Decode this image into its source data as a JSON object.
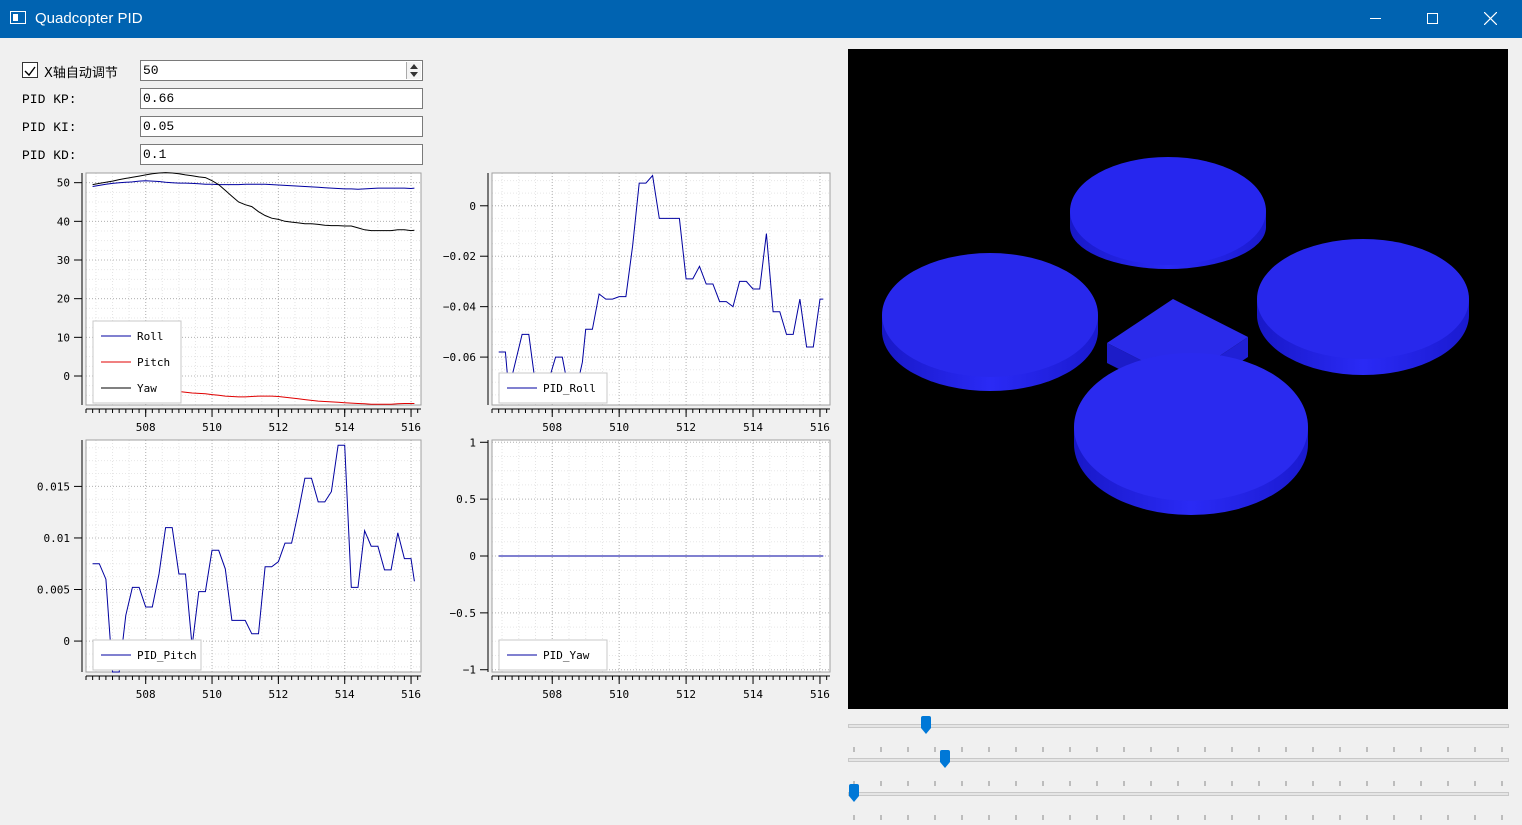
{
  "window": {
    "title": "Quadcopter PID"
  },
  "controls": {
    "auto_tune_label": "X轴自动调节",
    "auto_tune_checked": true,
    "spin_value": "50",
    "kp_label": "PID KP:",
    "kp_value": "0.66",
    "ki_label": "PID KI:",
    "ki_value": "0.05",
    "kd_label": "PID KD:",
    "kd_value": "0.1"
  },
  "chart_data": [
    {
      "type": "line",
      "x": [
        506.4,
        506.6,
        506.8,
        507.0,
        507.2,
        507.4,
        507.6,
        507.8,
        508.0,
        508.2,
        508.4,
        508.6,
        508.8,
        509.0,
        509.2,
        509.4,
        509.6,
        509.8,
        510.0,
        510.2,
        510.4,
        510.6,
        510.8,
        511.0,
        511.2,
        511.4,
        511.6,
        511.8,
        512.0,
        512.2,
        512.4,
        512.6,
        512.8,
        513.0,
        513.2,
        513.4,
        513.6,
        513.8,
        514.0,
        514.2,
        514.4,
        514.6,
        514.8,
        515.0,
        515.2,
        515.4,
        515.6,
        515.8,
        516.0,
        516.1
      ],
      "series": [
        {
          "name": "Roll",
          "color": "#0000a0",
          "values": [
            49,
            49.3,
            49.6,
            49.8,
            50,
            50.1,
            50.2,
            50.4,
            50.5,
            50.4,
            50.3,
            50.1,
            50,
            49.9,
            49.9,
            49.8,
            49.7,
            49.6,
            49.6,
            49.5,
            49.5,
            49.5,
            49.5,
            49.6,
            49.6,
            49.6,
            49.6,
            49.5,
            49.4,
            49.3,
            49.2,
            49.1,
            49,
            48.9,
            48.8,
            48.7,
            48.6,
            48.5,
            48.4,
            48.4,
            48.3,
            48.4,
            48.5,
            48.6,
            48.6,
            48.6,
            48.6,
            48.6,
            48.5,
            48.6
          ]
        },
        {
          "name": "Pitch",
          "color": "#e00000",
          "values": [
            -1.3,
            -1.5,
            -1.8,
            -2,
            -2.2,
            -2.4,
            -2.6,
            -2.8,
            -3,
            -3.2,
            -3.4,
            -3.6,
            -3.8,
            -4,
            -4.2,
            -4.4,
            -4.5,
            -4.6,
            -4.8,
            -5,
            -5.2,
            -5.3,
            -5.4,
            -5.4,
            -5.3,
            -5.2,
            -5.2,
            -5.2,
            -5.3,
            -5.5,
            -5.7,
            -5.9,
            -6.1,
            -6.3,
            -6.5,
            -6.6,
            -6.7,
            -6.8,
            -6.9,
            -7,
            -7.1,
            -7.2,
            -7.3,
            -7.3,
            -7.3,
            -7.3,
            -7.2,
            -7.1,
            -7.1,
            -7.1
          ]
        },
        {
          "name": "Yaw",
          "color": "#000000",
          "values": [
            49.5,
            49.8,
            50.1,
            50.4,
            50.8,
            51.1,
            51.4,
            51.7,
            52,
            52.3,
            52.5,
            52.6,
            52.5,
            52.3,
            52,
            51.8,
            51.5,
            51.3,
            50.5,
            49.5,
            48,
            46.5,
            45,
            44.3,
            43.8,
            42.5,
            41.5,
            40.8,
            40.5,
            40,
            39.8,
            39.6,
            39.4,
            39.4,
            39.2,
            39,
            38.9,
            38.9,
            38.8,
            38.8,
            38.3,
            37.8,
            37.6,
            37.6,
            37.6,
            37.6,
            37.8,
            37.8,
            37.6,
            37.7
          ]
        }
      ],
      "xlim": [
        506.2,
        516.3
      ],
      "ylim": [
        -7.5,
        52.5
      ],
      "xticks": [
        508,
        510,
        512,
        514,
        516
      ],
      "yticks": [
        0,
        10,
        20,
        30,
        40,
        50
      ],
      "ytick_labels": [
        "0",
        "10",
        "20",
        "30",
        "40",
        "50"
      ],
      "legend": "bottom-left",
      "grid": true
    },
    {
      "type": "line",
      "x": [
        506.4,
        506.6,
        506.7,
        506.9,
        507.1,
        507.3,
        507.5,
        507.7,
        507.9,
        508.1,
        508.3,
        508.5,
        508.7,
        508.9,
        509.0,
        509.2,
        509.4,
        509.6,
        509.8,
        510.0,
        510.2,
        510.4,
        510.6,
        510.8,
        511.0,
        511.2,
        511.4,
        511.6,
        511.8,
        512.0,
        512.2,
        512.4,
        512.6,
        512.8,
        513.0,
        513.2,
        513.4,
        513.6,
        513.8,
        514.0,
        514.2,
        514.4,
        514.6,
        514.8,
        515.0,
        515.2,
        515.4,
        515.6,
        515.8,
        516.0,
        516.1
      ],
      "series": [
        {
          "name": "PID_Roll",
          "color": "#0000a0",
          "values": [
            -0.058,
            -0.058,
            -0.073,
            -0.062,
            -0.051,
            -0.051,
            -0.071,
            -0.069,
            -0.069,
            -0.06,
            -0.06,
            -0.074,
            -0.074,
            -0.062,
            -0.049,
            -0.049,
            -0.035,
            -0.037,
            -0.037,
            -0.036,
            -0.036,
            -0.016,
            0.009,
            0.009,
            0.012,
            -0.005,
            -0.005,
            -0.005,
            -0.005,
            -0.029,
            -0.029,
            -0.024,
            -0.031,
            -0.031,
            -0.038,
            -0.038,
            -0.04,
            -0.03,
            -0.03,
            -0.033,
            -0.033,
            -0.011,
            -0.042,
            -0.042,
            -0.051,
            -0.051,
            -0.037,
            -0.056,
            -0.056,
            -0.037,
            -0.037
          ]
        }
      ],
      "xlim": [
        506.2,
        516.3
      ],
      "ylim": [
        -0.079,
        0.013
      ],
      "xticks": [
        508,
        510,
        512,
        514,
        516
      ],
      "yticks": [
        0,
        -0.02,
        -0.04,
        -0.06
      ],
      "ytick_labels": [
        "0",
        "−0.02",
        "−0.04",
        "−0.06"
      ],
      "legend": "bottom-left",
      "grid": true
    },
    {
      "type": "line",
      "x": [
        506.4,
        506.6,
        506.8,
        507.0,
        507.2,
        507.4,
        507.6,
        507.8,
        508.0,
        508.2,
        508.4,
        508.6,
        508.8,
        509.0,
        509.2,
        509.4,
        509.6,
        509.8,
        510.0,
        510.2,
        510.4,
        510.6,
        510.8,
        511.0,
        511.2,
        511.4,
        511.6,
        511.8,
        512.0,
        512.2,
        512.4,
        512.6,
        512.8,
        513.0,
        513.2,
        513.4,
        513.6,
        513.8,
        514.0,
        514.2,
        514.4,
        514.6,
        514.8,
        515.0,
        515.2,
        515.4,
        515.6,
        515.8,
        516.0,
        516.1
      ],
      "series": [
        {
          "name": "PID_Pitch",
          "color": "#0000a0",
          "values": [
            0.0075,
            0.0075,
            0.006,
            -0.003,
            -0.003,
            0.0025,
            0.0052,
            0.0052,
            0.0033,
            0.0033,
            0.0065,
            0.011,
            0.011,
            0.0065,
            0.0065,
            -0.0005,
            0.0048,
            0.0048,
            0.0088,
            0.0088,
            0.007,
            0.002,
            0.002,
            0.002,
            0.0007,
            0.0007,
            0.0072,
            0.0072,
            0.0077,
            0.0095,
            0.0095,
            0.0125,
            0.0158,
            0.0158,
            0.0135,
            0.0135,
            0.0145,
            0.019,
            0.019,
            0.0052,
            0.0052,
            0.0107,
            0.0092,
            0.0092,
            0.0069,
            0.0069,
            0.0105,
            0.008,
            0.008,
            0.0058
          ]
        }
      ],
      "xlim": [
        506.2,
        516.3
      ],
      "ylim": [
        -0.003,
        0.0195
      ],
      "xticks": [
        508,
        510,
        512,
        514,
        516
      ],
      "yticks": [
        0,
        0.005,
        0.01,
        0.015
      ],
      "ytick_labels": [
        "0",
        "0.005",
        "0.01",
        "0.015"
      ],
      "legend": "bottom-left",
      "grid": true
    },
    {
      "type": "line",
      "x": [
        506.4,
        516.1
      ],
      "series": [
        {
          "name": "PID_Yaw",
          "color": "#0000a0",
          "values": [
            0,
            0
          ]
        }
      ],
      "xlim": [
        506.2,
        516.3
      ],
      "ylim": [
        -1.02,
        1.02
      ],
      "xticks": [
        508,
        510,
        512,
        514,
        516
      ],
      "yticks": [
        1,
        0.5,
        0,
        -0.5,
        -1
      ],
      "ytick_labels": [
        "1",
        "0.5",
        "0",
        "−0.5",
        "−1"
      ],
      "legend": "bottom-left",
      "grid": true
    }
  ],
  "scene": {
    "background": "#000000",
    "rotor_color": "#2020f0",
    "body_color": "#2424e0"
  },
  "sliders": [
    {
      "value_fraction": 0.11
    },
    {
      "value_fraction": 0.14
    },
    {
      "value_fraction": 0.0
    }
  ]
}
